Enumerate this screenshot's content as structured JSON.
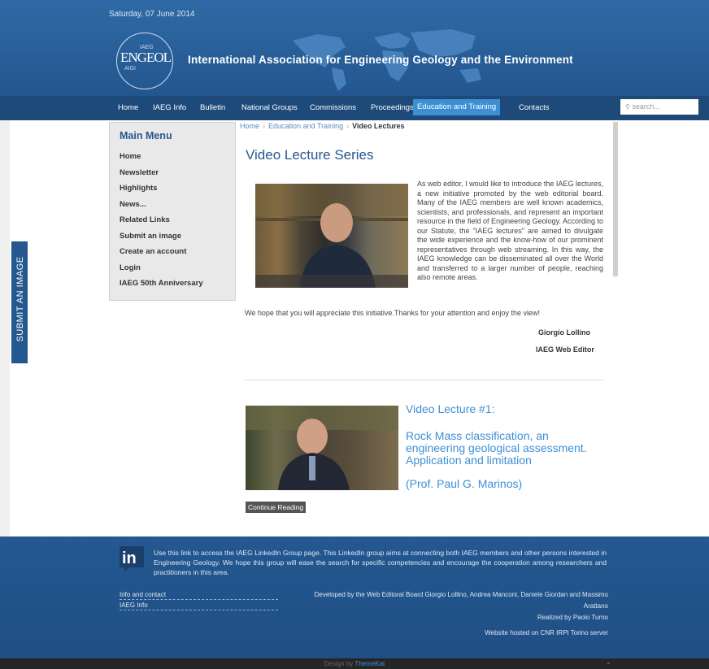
{
  "header": {
    "date": "Saturday, 07 June 2014",
    "logo": {
      "main_left": "EN",
      "main_right": "GEOL",
      "small_top": "IAEG",
      "small_left": "AIGI"
    },
    "site_title": "International Association for Engineering Geology and the Environment"
  },
  "nav": {
    "items": [
      "Home",
      "IAEG Info",
      "Bulletin",
      "National Groups",
      "Commissions",
      "Proceedings",
      "Education and Training",
      "Contacts"
    ],
    "active": "Education and Training",
    "search_placeholder": "search..."
  },
  "submit_tab": "SUBMIT AN IMAGE",
  "main_menu": {
    "title": "Main Menu",
    "items": [
      "Home",
      "Newsletter",
      "Highlights",
      "News...",
      "Related Links",
      "Submit an image",
      "Create an account",
      "Login",
      "IAEG 50th Anniversary"
    ]
  },
  "breadcrumb": {
    "home": "Home",
    "section": "Education and Training",
    "current": "Video Lectures"
  },
  "content": {
    "title": "Video Lecture Series",
    "intro": "As web editor, I would like to introduce the IAEG lectures, a new initiative promoted by the web editorial board. Many of the IAEG members are well known academics, scientists, and professionals, and represent an important resource in the field of Engineering Geology. According to our Statute, the \"IAEG lectures\" are aimed to divulgate the wide experience and the know-how of our prominent representatives through web streaming. In this way, the IAEG knowledge can be disseminated all over the World and transferred to a larger number of people, reaching also remote areas.",
    "thanks": "We hope that you will appreciate this initiative.Thanks for your attention and enjoy the view!",
    "signature_name": "Giorgio Lollino",
    "signature_role": "IAEG Web Editor",
    "lecture": {
      "title": "Video Lecture #1:",
      "subtitle": "Rock Mass classification, an engineering geological assessment. Application and limitation",
      "author": "(Prof. Paul G. Marinos)",
      "button": "Continue Reading"
    }
  },
  "footer": {
    "linkedin_text": "Use this link to access the IAEG LinkedIn Group page. This LinkedIn group aims at connecting both IAEG members and other persons interested in Engineering Geology. We hope this group will ease the search for specific competencies and encourage the cooperation among researchers and practitioners in this area.",
    "links": [
      "Info and contact",
      "IAEG Info"
    ],
    "developed_by": "Developed by the Web Editoral Board Giorgio Lollino, Andrea Manconi, Daniele Giordan and Massimo Arattano",
    "realized_by": "Realized by Paolo Turno",
    "hosted": "Website hosted on CNR IRPI Torino server",
    "design_prefix": "Design by",
    "design_by": "ThemeKat"
  }
}
